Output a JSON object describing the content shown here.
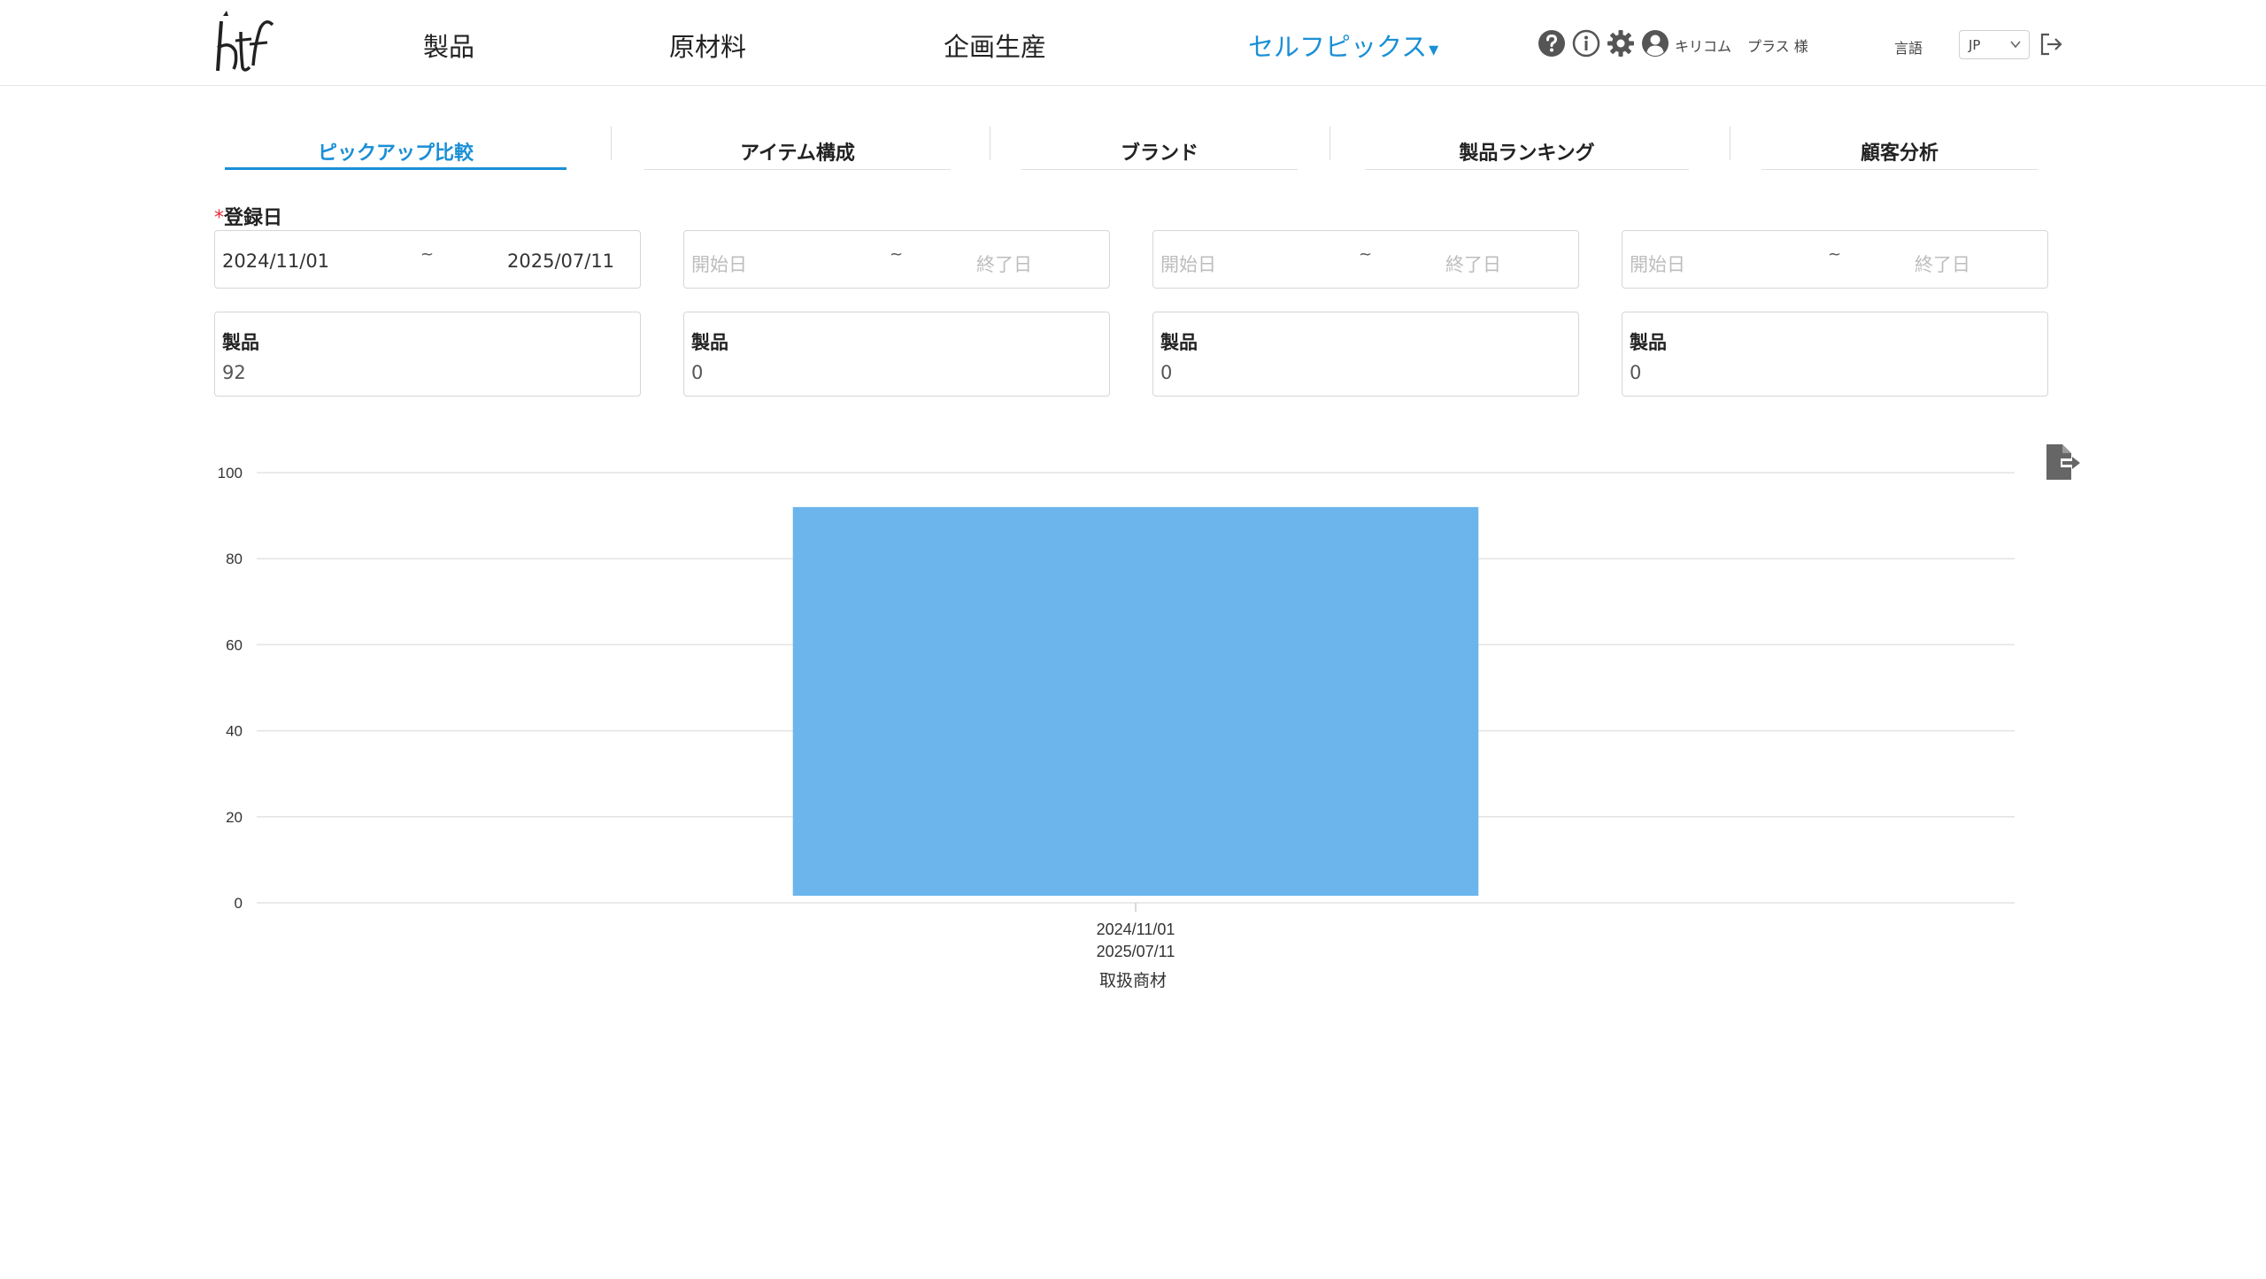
{
  "header": {
    "nav": [
      {
        "label": "製品"
      },
      {
        "label": "原材料"
      },
      {
        "label": "企画生産"
      },
      {
        "label": "セルフピックス",
        "caret": "▾"
      }
    ],
    "icons": [
      "help-icon",
      "info-icon",
      "settings-icon",
      "user-icon"
    ],
    "user_name": "キリコム",
    "user_suffix": "プラス 様",
    "lang_label": "言語",
    "lang_value": "JP",
    "accent_color": "#1a8fd6"
  },
  "tabs": [
    {
      "label": "ピックアップ比較",
      "active": true
    },
    {
      "label": "アイテム構成"
    },
    {
      "label": "ブランド"
    },
    {
      "label": "製品ランキング"
    },
    {
      "label": "顧客分析"
    }
  ],
  "filters": {
    "required_mark": "*",
    "date_label": "登録日",
    "separator": "~",
    "date_ranges": [
      {
        "start": "2024/11/01",
        "end": "2025/07/11"
      },
      {
        "start_placeholder": "開始日",
        "end_placeholder": "終了日"
      },
      {
        "start_placeholder": "開始日",
        "end_placeholder": "終了日"
      },
      {
        "start_placeholder": "開始日",
        "end_placeholder": "終了日"
      }
    ],
    "counts": [
      {
        "label": "製品",
        "value": "92"
      },
      {
        "label": "製品",
        "value": "0"
      },
      {
        "label": "製品",
        "value": "0"
      },
      {
        "label": "製品",
        "value": "0"
      }
    ]
  },
  "chart_data": {
    "type": "bar",
    "categories": [
      [
        "2024/11/01",
        "2025/07/11"
      ]
    ],
    "values": [
      92
    ],
    "xlabel": "取扱商材",
    "ylabel": "",
    "ylim": [
      0,
      100
    ],
    "yticks": [
      0,
      20,
      40,
      60,
      80,
      100
    ],
    "grid": true,
    "bar_color": "#6cb5ec"
  }
}
